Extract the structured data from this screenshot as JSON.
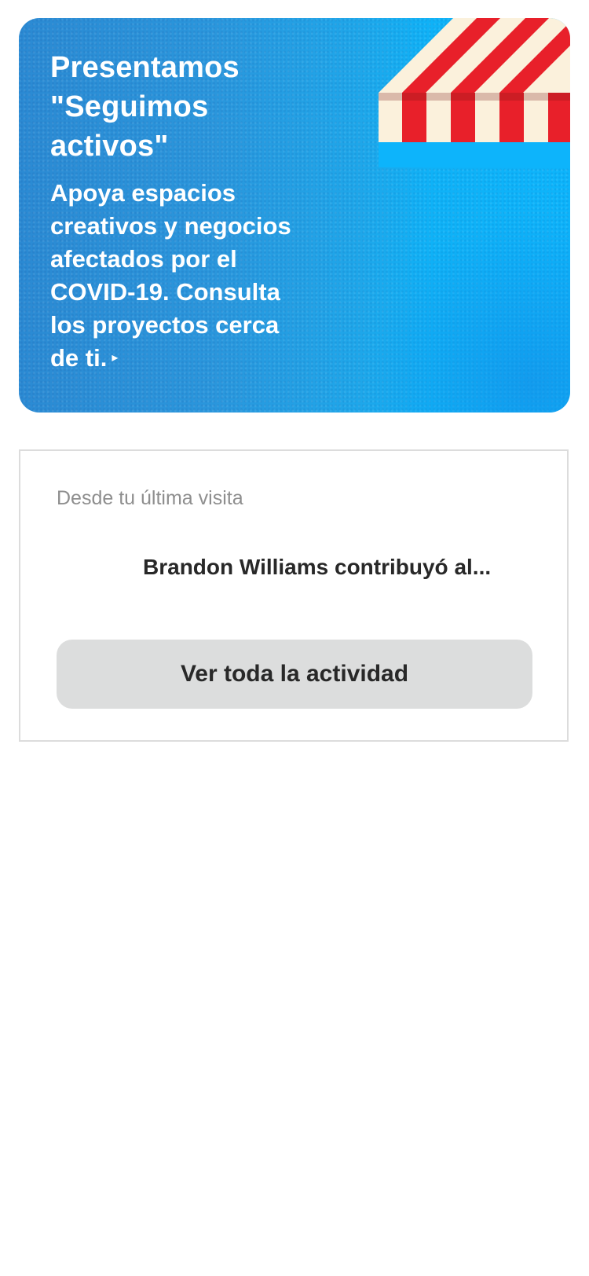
{
  "promo": {
    "title": "Presentamos \"Seguimos activos\"",
    "body": "Apoya espacios creativos y negocios afectados por el COVID-19. Consulta los proyectos cerca de ti.",
    "arrow_glyph": "▸",
    "colors": {
      "background_start": "#2b8ad3",
      "background_end": "#0db4fb",
      "awning_red": "#e8202a",
      "awning_cream": "#fbf1dc"
    }
  },
  "activity": {
    "heading": "Desde tu última visita",
    "items": [
      {
        "text": "Brandon Williams contribuyó al..."
      }
    ],
    "view_all_label": "Ver toda la actividad"
  }
}
